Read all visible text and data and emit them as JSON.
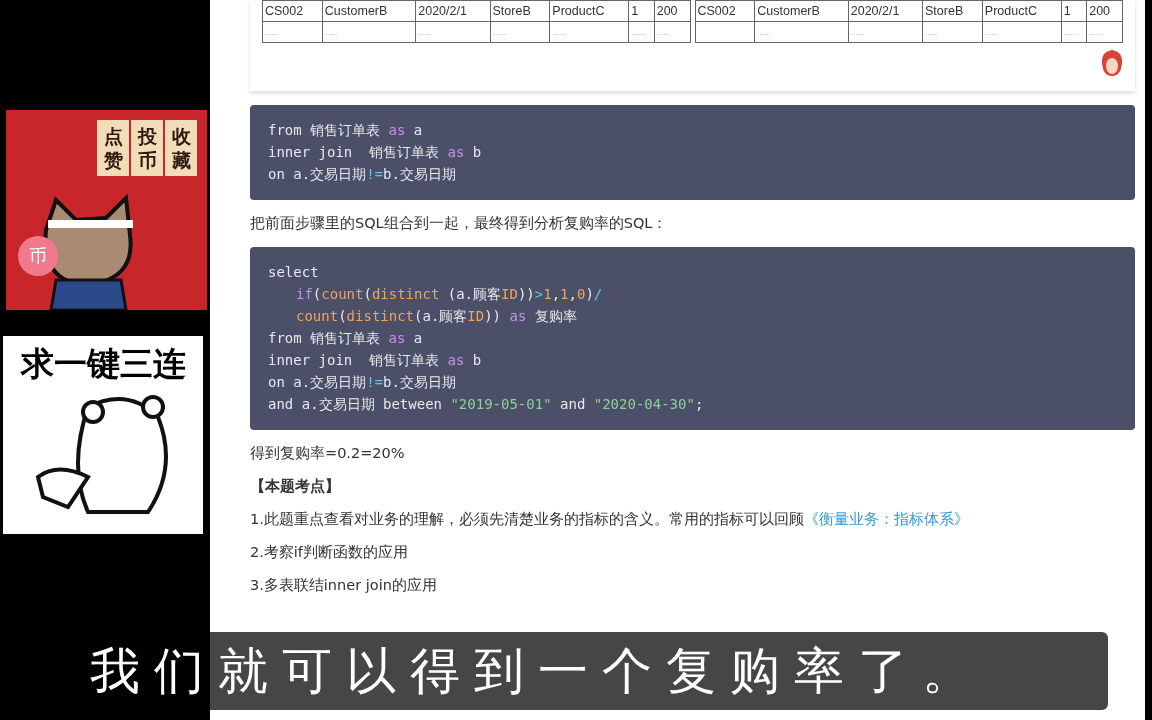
{
  "sidebar": {
    "sticker_top": {
      "labels": [
        "点赞",
        "投币",
        "收藏"
      ],
      "coin": "币"
    },
    "sticker_bottom": {
      "caption": "求一键三连"
    }
  },
  "tables": [
    {
      "rows": [
        [
          "CS002",
          "CustomerB",
          "2020/2/1",
          "StoreB",
          "ProductC",
          "1",
          "200"
        ],
        [
          "......",
          "......",
          "......",
          "......",
          "......",
          "......",
          "......"
        ]
      ]
    },
    {
      "rows": [
        [
          "CS002",
          "CustomerB",
          "2020/2/1",
          "StoreB",
          "ProductC",
          "1",
          "200"
        ],
        [
          "",
          "......",
          "......",
          "......",
          "......",
          "......",
          "......"
        ]
      ]
    }
  ],
  "code_blocks": [
    {
      "lines": [
        {
          "indent": false,
          "tokens": [
            {
              "kind": "plain",
              "text": "from 销售订单表 "
            },
            {
              "kind": "keyword",
              "text": "as"
            },
            {
              "kind": "plain",
              "text": " a"
            }
          ]
        },
        {
          "indent": false,
          "tokens": [
            {
              "kind": "plain",
              "text": "inner join  销售订单表 "
            },
            {
              "kind": "keyword",
              "text": "as"
            },
            {
              "kind": "plain",
              "text": " b"
            }
          ]
        },
        {
          "indent": false,
          "tokens": [
            {
              "kind": "plain",
              "text": "on a.交易日期"
            },
            {
              "kind": "op",
              "text": "!="
            },
            {
              "kind": "plain",
              "text": "b.交易日期"
            }
          ]
        }
      ]
    },
    {
      "lines": [
        {
          "indent": false,
          "tokens": [
            {
              "kind": "plain",
              "text": "select"
            }
          ]
        },
        {
          "indent": true,
          "tokens": [
            {
              "kind": "keyword",
              "text": "if"
            },
            {
              "kind": "plain",
              "text": "("
            },
            {
              "kind": "func",
              "text": "count"
            },
            {
              "kind": "plain",
              "text": "("
            },
            {
              "kind": "func",
              "text": "distinct"
            },
            {
              "kind": "plain",
              "text": " (a.顾客"
            },
            {
              "kind": "func",
              "text": "ID"
            },
            {
              "kind": "plain",
              "text": "))"
            },
            {
              "kind": "op",
              "text": ">"
            },
            {
              "kind": "func",
              "text": "1"
            },
            {
              "kind": "plain",
              "text": ","
            },
            {
              "kind": "func",
              "text": "1"
            },
            {
              "kind": "plain",
              "text": ","
            },
            {
              "kind": "func",
              "text": "0"
            },
            {
              "kind": "plain",
              "text": ")"
            },
            {
              "kind": "op",
              "text": "/"
            }
          ]
        },
        {
          "indent": true,
          "tokens": [
            {
              "kind": "func",
              "text": "count"
            },
            {
              "kind": "plain",
              "text": "("
            },
            {
              "kind": "func",
              "text": "distinct"
            },
            {
              "kind": "plain",
              "text": "(a.顾客"
            },
            {
              "kind": "func",
              "text": "ID"
            },
            {
              "kind": "plain",
              "text": ")) "
            },
            {
              "kind": "keyword",
              "text": "as"
            },
            {
              "kind": "plain",
              "text": " 复购率"
            }
          ]
        },
        {
          "indent": false,
          "tokens": [
            {
              "kind": "plain",
              "text": "from 销售订单表 "
            },
            {
              "kind": "keyword",
              "text": "as"
            },
            {
              "kind": "plain",
              "text": " a"
            }
          ]
        },
        {
          "indent": false,
          "tokens": [
            {
              "kind": "plain",
              "text": "inner join  销售订单表 "
            },
            {
              "kind": "keyword",
              "text": "as"
            },
            {
              "kind": "plain",
              "text": " b"
            }
          ]
        },
        {
          "indent": false,
          "tokens": [
            {
              "kind": "plain",
              "text": "on a.交易日期"
            },
            {
              "kind": "op",
              "text": "!="
            },
            {
              "kind": "plain",
              "text": "b.交易日期"
            }
          ]
        },
        {
          "indent": false,
          "tokens": [
            {
              "kind": "plain",
              "text": "and a.交易日期 between "
            },
            {
              "kind": "string",
              "text": "\"2019-05-01\""
            },
            {
              "kind": "plain",
              "text": " and "
            },
            {
              "kind": "string",
              "text": "\"2020-04-30\""
            },
            {
              "kind": "plain",
              "text": ";"
            }
          ]
        }
      ]
    }
  ],
  "paragraphs": [
    {
      "kind": "text",
      "text": "把前面步骤里的SQL组合到一起，最终得到分析复购率的SQL："
    },
    {
      "kind": "text",
      "text": "得到复购率=0.2=20%"
    },
    {
      "kind": "heading",
      "text": "【本题考点】"
    },
    {
      "kind": "text",
      "text": "1.此题重点查看对业务的理解，必须先清楚业务的指标的含义。常用的指标可以回顾",
      "link": "《衡量业务：指标体系》"
    },
    {
      "kind": "text",
      "text": "2.考察if判断函数的应用"
    },
    {
      "kind": "text",
      "text": "3.多表联结inner join的应用"
    }
  ],
  "subtitle": "我们就可以得到一个复购率了。"
}
